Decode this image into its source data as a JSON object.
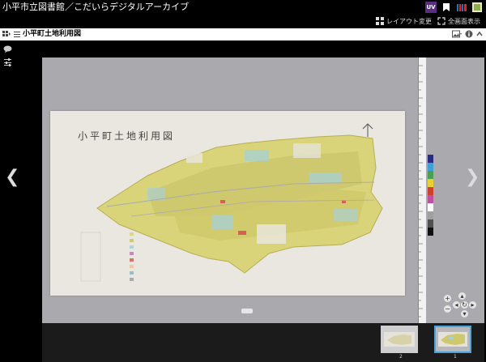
{
  "header": {
    "title": "小平市立図書館／こだいらデジタルアーカイブ",
    "icons": [
      "uv-logo-icon",
      "bookmark-icon",
      "iiif-icon",
      "share-icon"
    ]
  },
  "toolbar": {
    "layout_label": "レイアウト変更",
    "fullscreen_label": "全画面表示"
  },
  "document": {
    "title": "小平町土地利用図"
  },
  "map": {
    "heading": "小平町土地利用図"
  },
  "thumbnails": [
    {
      "number": "2",
      "selected": false
    },
    {
      "number": "1",
      "selected": true
    }
  ],
  "colors": {
    "accent": "#4aa3d9",
    "uv_brand": "#5a2d82",
    "canvas_bg": "#aaa9ae"
  }
}
